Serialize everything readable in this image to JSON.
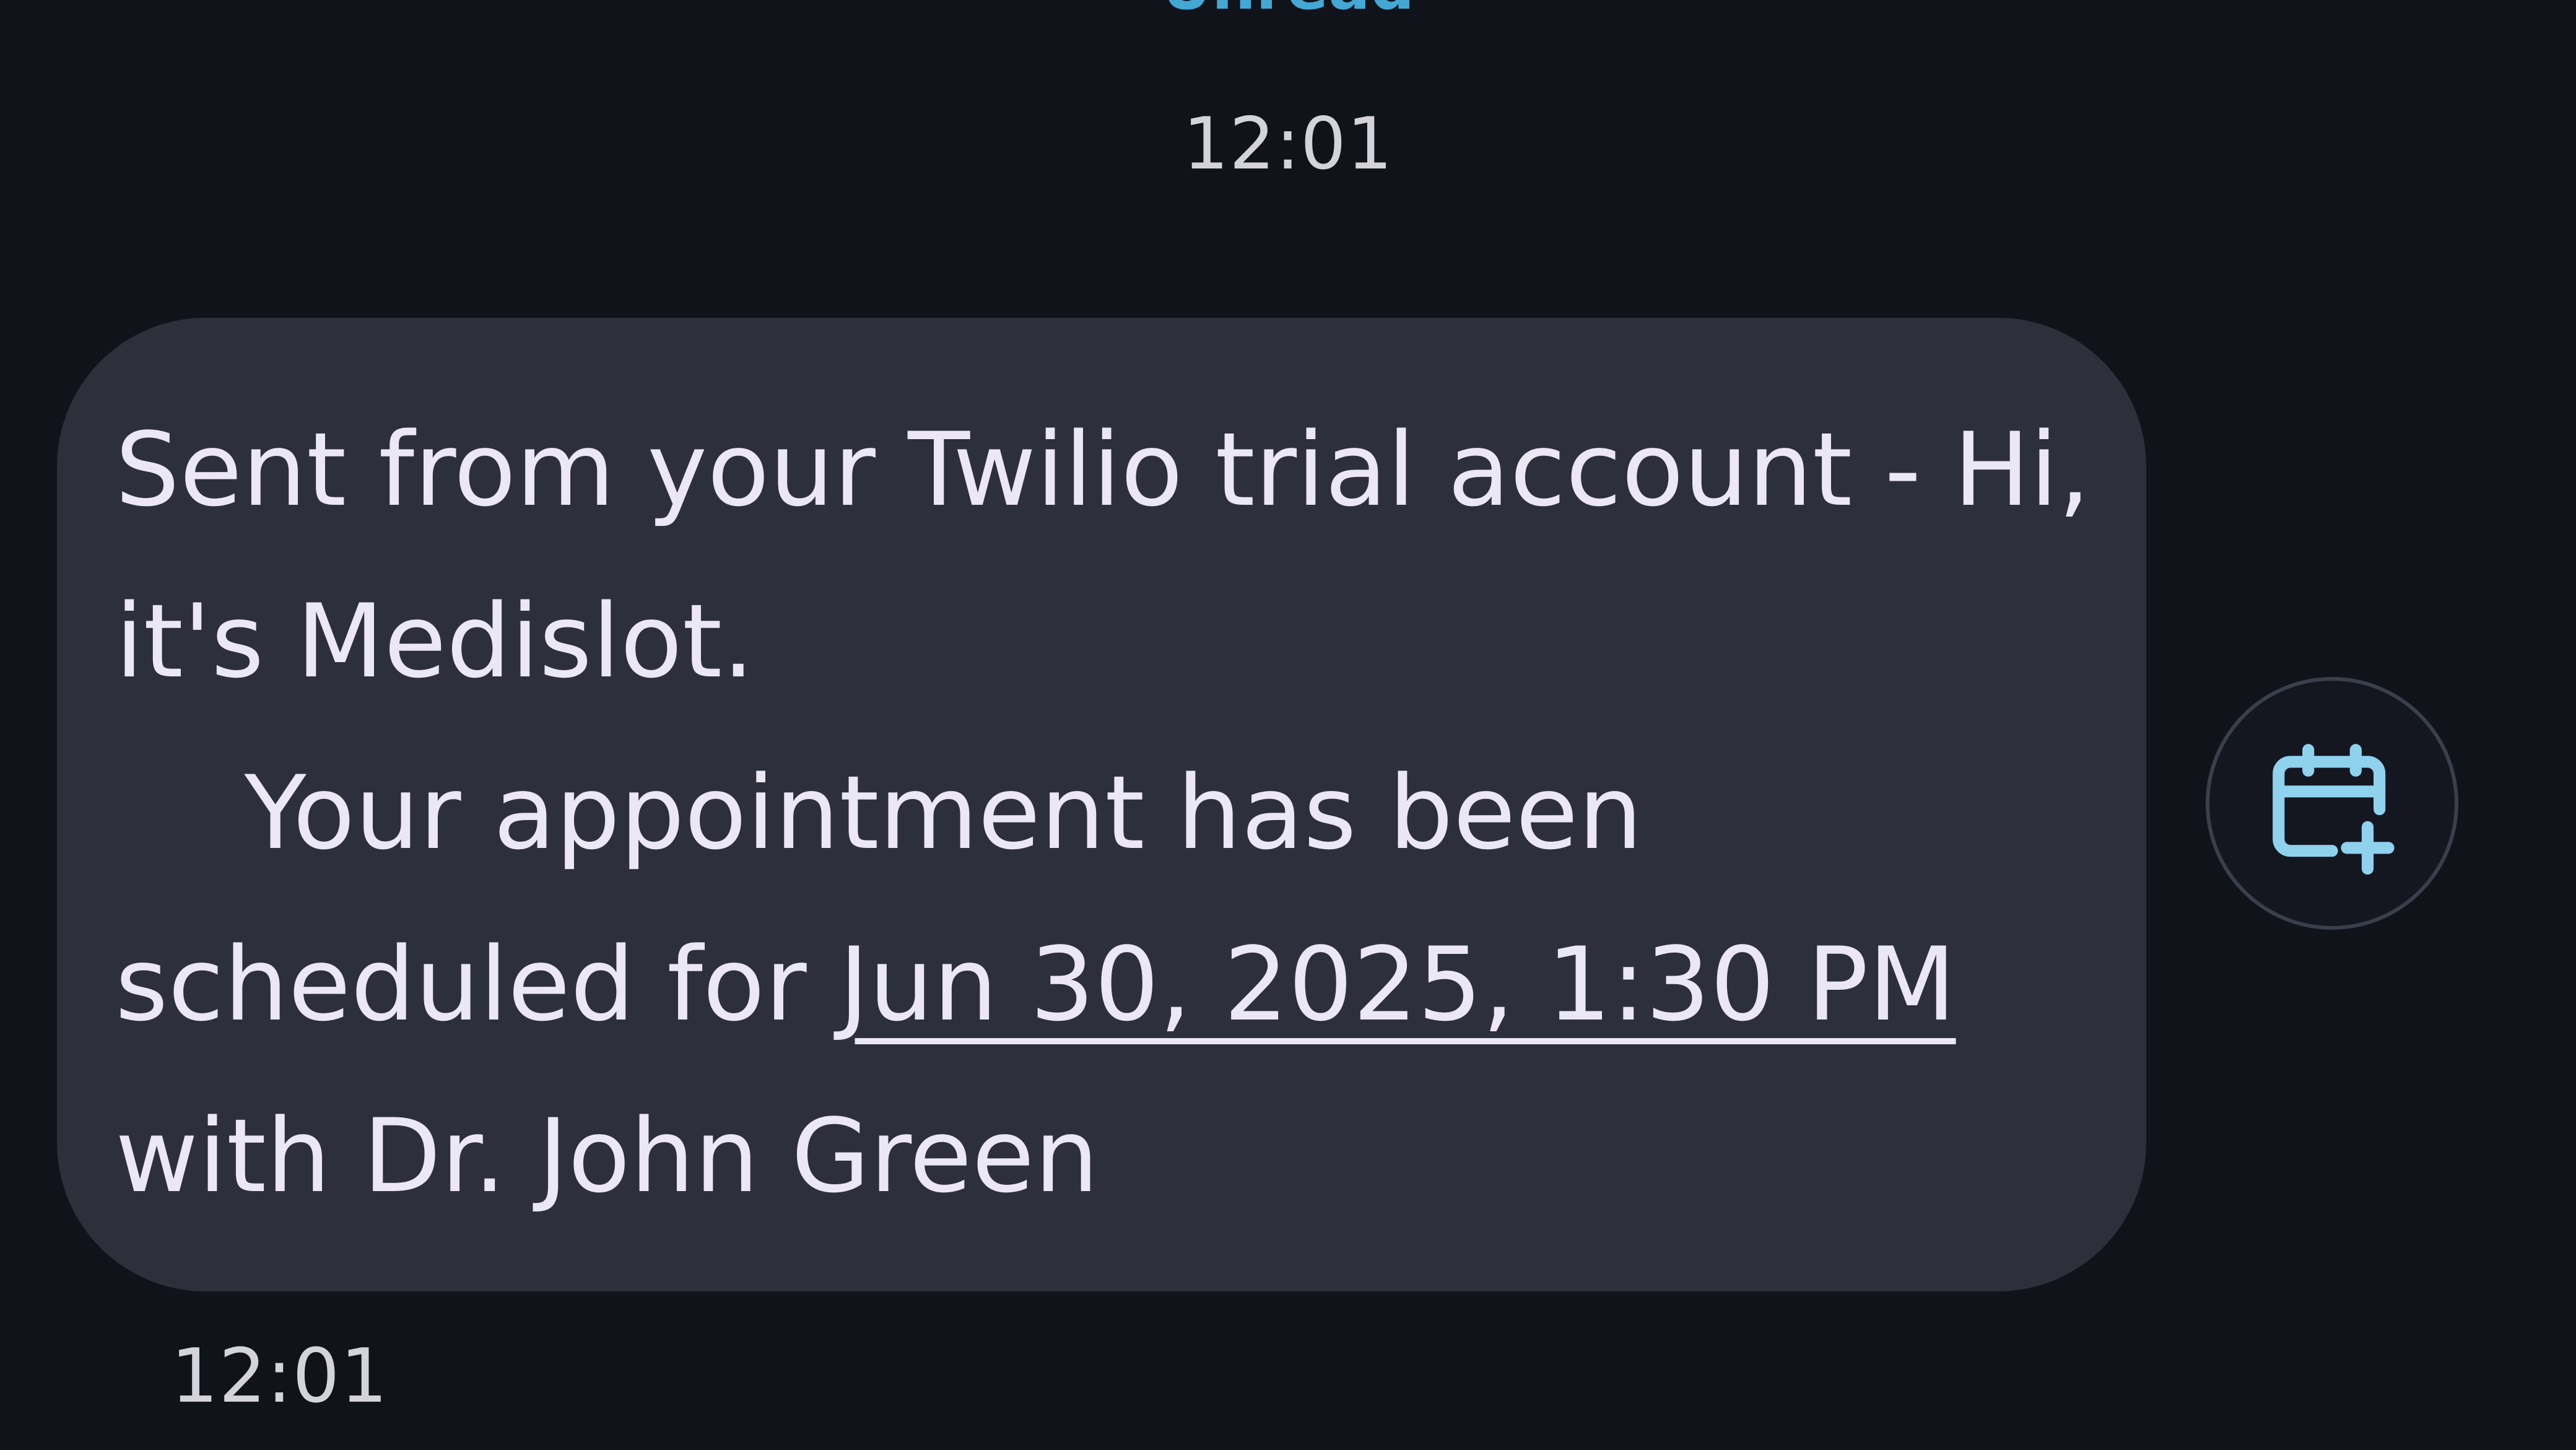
{
  "thread": {
    "divider_label": "Unread",
    "timestamp_top": "12:01"
  },
  "message": {
    "line_intro": "Sent from your Twilio trial account - Hi, it's Medislot.",
    "line_body_prefix": "    Your appointment has been scheduled for ",
    "date_link": "Jun 30, 2025, 1:30 PM",
    "line_body_suffix": " with Dr. John Green",
    "timestamp": "12:01"
  },
  "actions": {
    "add_to_calendar_icon": "calendar-add-icon",
    "accent_color": "#8fd2ee"
  },
  "colors": {
    "background": "#11131b",
    "bubble": "#2d2f3a",
    "text": "#ece7f4",
    "divider": "#43a8d4"
  }
}
